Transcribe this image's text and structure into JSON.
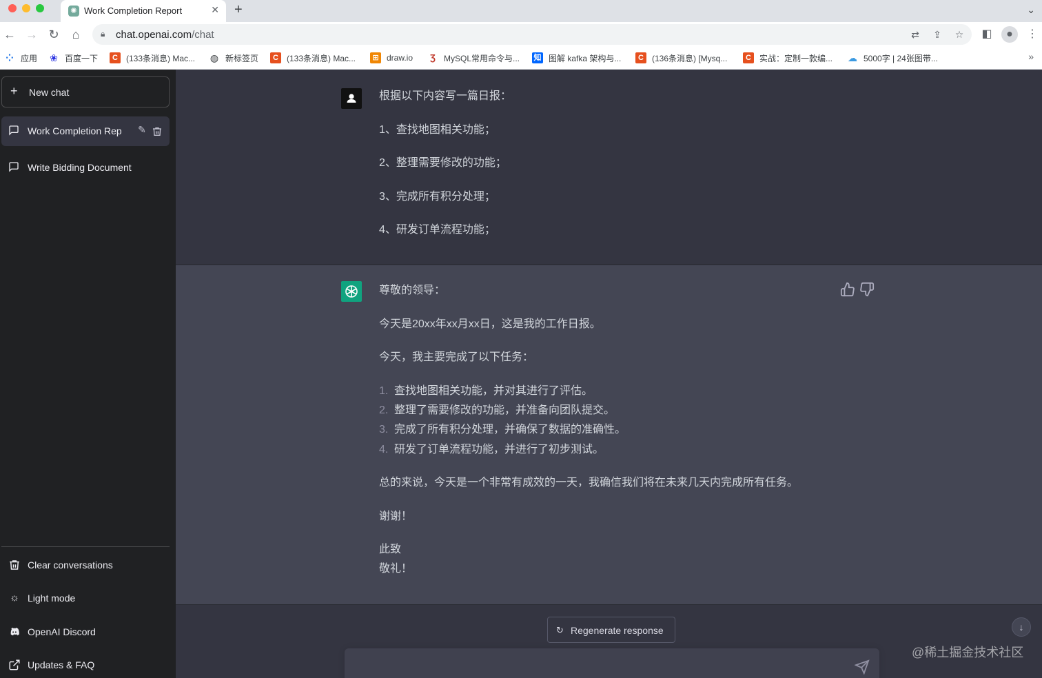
{
  "browser": {
    "tab_title": "Work Completion Report",
    "tab_close": "✕",
    "new_tab": "+",
    "url_host": "chat.openai.com",
    "url_path": "/chat",
    "bookmarks": [
      {
        "label": "应用",
        "icon": "apps-grid-icon"
      },
      {
        "label": "百度一下",
        "icon": "baidu-icon"
      },
      {
        "label": "(133条消息) Mac...",
        "icon": "csdn-icon"
      },
      {
        "label": "新标签页",
        "icon": "globe-icon"
      },
      {
        "label": "(133条消息) Mac...",
        "icon": "csdn-icon"
      },
      {
        "label": "draw.io",
        "icon": "drawio-icon"
      },
      {
        "label": "MySQL常用命令与...",
        "icon": "mysql-icon"
      },
      {
        "label": "图解 kafka 架构与...",
        "icon": "zhihu-icon"
      },
      {
        "label": "(136条消息) [Mysq...",
        "icon": "csdn-icon"
      },
      {
        "label": "实战：定制一款编...",
        "icon": "csdn-icon"
      },
      {
        "label": "5000字 | 24张图带...",
        "icon": "cloud-icon"
      }
    ]
  },
  "sidebar": {
    "new_chat": "New chat",
    "conversations": [
      {
        "label": "Work Completion Rep",
        "active": true
      },
      {
        "label": "Write Bidding Document",
        "active": false
      }
    ],
    "bottom": [
      {
        "label": "Clear conversations",
        "icon": "trash-icon"
      },
      {
        "label": "Light mode",
        "icon": "sun-icon"
      },
      {
        "label": "OpenAI Discord",
        "icon": "discord-icon"
      },
      {
        "label": "Updates & FAQ",
        "icon": "external-link-icon"
      }
    ]
  },
  "chat": {
    "user_message": {
      "intro": "根据以下内容写一篇日报：",
      "items": [
        "1、查找地图相关功能；",
        "2、整理需要修改的功能；",
        "3、完成所有积分处理；",
        "4、研发订单流程功能；"
      ]
    },
    "assistant_message": {
      "greeting": "尊敬的领导：",
      "p1": "今天是20xx年xx月xx日，这是我的工作日报。",
      "p2": "今天，我主要完成了以下任务：",
      "list": [
        {
          "num": "1.",
          "text": "查找地图相关功能，并对其进行了评估。"
        },
        {
          "num": "2.",
          "text": "整理了需要修改的功能，并准备向团队提交。"
        },
        {
          "num": "3.",
          "text": "完成了所有积分处理，并确保了数据的准确性。"
        },
        {
          "num": "4.",
          "text": "研发了订单流程功能，并进行了初步测试。"
        }
      ],
      "p3": "总的来说，今天是一个非常有成效的一天，我确信我们将在未来几天内完成所有任务。",
      "p4": "谢谢！",
      "closing1": "此致",
      "closing2": "敬礼！"
    },
    "regenerate": "Regenerate response",
    "input_placeholder": ""
  },
  "watermark": "@稀土掘金技术社区",
  "colors": {
    "sidebar_bg": "#202123",
    "main_bg": "#343541",
    "assistant_bg": "#444654",
    "openai_green": "#10a37f"
  }
}
